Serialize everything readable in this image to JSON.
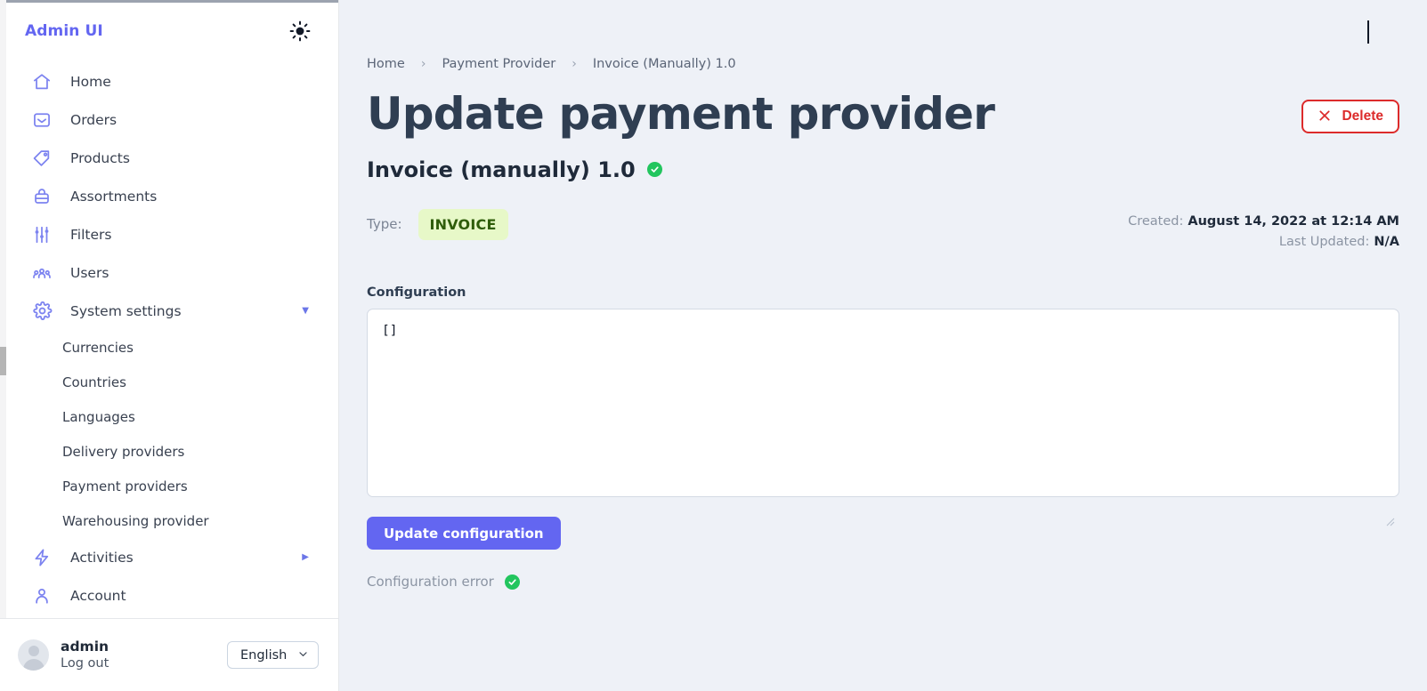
{
  "sidebar": {
    "brand": "Admin UI",
    "theme_toggle_icon": "sun-icon",
    "nav": [
      {
        "label": "Home",
        "icon": "home-icon"
      },
      {
        "label": "Orders",
        "icon": "inbox-icon"
      },
      {
        "label": "Products",
        "icon": "tag-icon"
      },
      {
        "label": "Assortments",
        "icon": "box-icon"
      },
      {
        "label": "Filters",
        "icon": "sliders-icon"
      },
      {
        "label": "Users",
        "icon": "users-icon"
      },
      {
        "label": "System settings",
        "icon": "gear-icon",
        "caret": "▼"
      },
      {
        "label": "Activities",
        "icon": "bolt-icon",
        "caret": "▶"
      },
      {
        "label": "Account",
        "icon": "person-icon"
      }
    ],
    "sub_nav": [
      {
        "label": "Currencies"
      },
      {
        "label": "Countries"
      },
      {
        "label": "Languages"
      },
      {
        "label": "Delivery providers"
      },
      {
        "label": "Payment providers"
      },
      {
        "label": "Warehousing provider"
      }
    ],
    "footer": {
      "user_name": "admin",
      "logout_label": "Log out",
      "language_value": "English",
      "language_caret_icon": "chevron-down-icon",
      "avatar_icon": "avatar"
    }
  },
  "main": {
    "breadcrumb": [
      {
        "label": "Home"
      },
      {
        "label": "Payment Provider"
      },
      {
        "label": "Invoice (Manually) 1.0"
      }
    ],
    "breadcrumb_separator": "›",
    "page_title": "Update payment provider",
    "delete_button": {
      "label": "Delete",
      "icon": "close-icon",
      "color": "#dc2b2b"
    },
    "subtitle": "Invoice (manually) 1.0",
    "subtitle_status_icon": "check-circle-icon",
    "type_label": "Type:",
    "type_badge": "INVOICE",
    "type_badge_bg": "#e7f8c8",
    "type_badge_color": "#2f5d0a",
    "created_label": "Created:",
    "created_value": "August 14, 2022 at 12:14 AM",
    "last_updated_label": "Last Updated:",
    "last_updated_value": "N/A",
    "configuration_label": "Configuration",
    "configuration_value": "[]",
    "configuration_placeholder": "",
    "update_button": "Update configuration",
    "update_button_color": "#6366f1",
    "error_label": "Configuration error",
    "error_status_icon": "check-circle-icon",
    "error_status_color": "#22c55e"
  }
}
